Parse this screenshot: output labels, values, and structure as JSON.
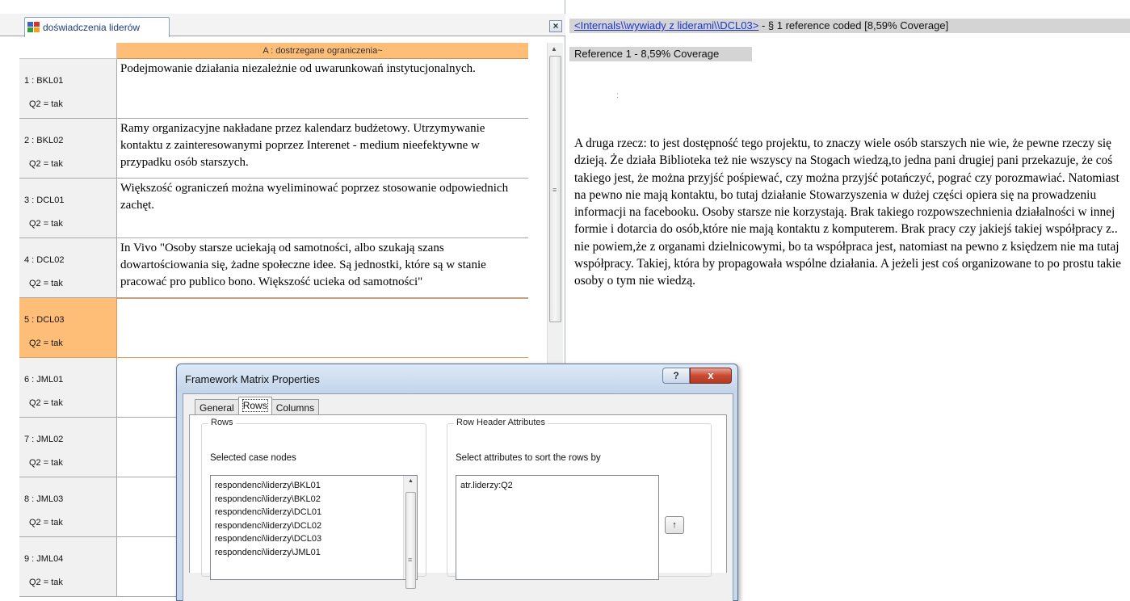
{
  "framework": {
    "tab_label": "doświadczenia liderów",
    "close_label": "×",
    "column_header": "A : dostrzegane ograniczenia~",
    "rows": [
      {
        "id": "1 : BKL01",
        "attr": "Q2 = tak",
        "text": "Podejmowanie działania niezależnie od uwarunkowań instytucjonalnych."
      },
      {
        "id": "2 : BKL02",
        "attr": "Q2 = tak",
        "text": "Ramy organizacyjne nakładane przez kalendarz budżetowy. Utrzymywanie kontaktu z zainteresowanymi poprzez Interenet - medium nieefektywne w przypadku osób starszych."
      },
      {
        "id": "3 : DCL01",
        "attr": "Q2 = tak",
        "text": "Większość ograniczeń można wyeliminować poprzez stosowanie odpowiednich zachęt."
      },
      {
        "id": "4 : DCL02",
        "attr": "Q2 = tak",
        "text": "In Vivo \"Osoby starsze uciekają od samotności, albo szukają szans dowartościowania się, żadne społeczne idee. Są jednostki, które są w stanie pracować pro publico bono. Większość ucieka od samotności\""
      },
      {
        "id": "5 : DCL03",
        "attr": "Q2 = tak",
        "text": ""
      },
      {
        "id": "6 : JML01",
        "attr": "Q2 = tak",
        "text": ""
      },
      {
        "id": "7 : JML02",
        "attr": "Q2 = tak",
        "text": ""
      },
      {
        "id": "8 : JML03",
        "attr": "Q2 = tak",
        "text": ""
      },
      {
        "id": "9 : JML04",
        "attr": "Q2 = tak",
        "text": ""
      }
    ],
    "selected_row_index": 4
  },
  "reference": {
    "link_text": "<Internals\\\\wywiady z liderami\\\\DCL03>",
    "summary": " - § 1 reference coded  [8,59% Coverage]",
    "label": "Reference 1 - 8,59% Coverage",
    "small_mark": ":",
    "passage": "A druga rzecz: to jest dostępność tego projektu, to znaczy wiele osób starszych nie wie, że pewne rzeczy się dzieją. Że działa Biblioteka też nie wszyscy na Stogach wiedzą,to jedna pani drugiej pani przekazuje, że coś takiego jest, że można przyjść pośpiewać, czy można przyjść potańczyć, pograć czy porozmawiać. Natomiast na pewno nie mają kontaktu, bo tutaj działanie Stowarzyszenia w dużej części opiera się na prowadzeniu informacji na facebooku. Osoby starsze nie korzystają. Brak takiego rozpowszechnienia działalności w innej formie i dotarcia do osób,które nie mają kontaktu z komputerem. Brak pracy czy jakiejś takiej współpracy z.. nie powiem,że z organami dzielnicowymi, bo ta współpraca jest, natomiast na pewno z księdzem nie ma tutaj współpracy. Takiej, która by propagowała wspólne działania. A jeżeli jest coś organizowane to po prostu takie osoby o tym nie wiedzą."
  },
  "dialog": {
    "title": "Framework Matrix Properties",
    "help_label": "?",
    "close_label": "x",
    "tabs": [
      {
        "label": "General",
        "active": false
      },
      {
        "label": "Rows",
        "active": true
      },
      {
        "label": "Columns",
        "active": false
      }
    ],
    "rows_group": {
      "legend": "Rows",
      "sublabel": "Selected case nodes",
      "items": [
        "respondenci\\liderzy\\BKL01",
        "respondenci\\liderzy\\BKL02",
        "respondenci\\liderzy\\DCL01",
        "respondenci\\liderzy\\DCL02",
        "respondenci\\liderzy\\DCL03",
        "respondenci\\liderzy\\JML01"
      ]
    },
    "attr_group": {
      "legend": "Row Header Attributes",
      "sublabel": "Select attributes to sort the rows by",
      "items": [
        "atr.liderzy:Q2"
      ],
      "button_label": "↑"
    }
  },
  "colors": {
    "header_orange": "#ffbe78",
    "link_blue": "#1b35c8",
    "ref_gray": "#d4d4d4",
    "dialog_frame": "#c8d8ea",
    "close_red": "#c94a32"
  }
}
